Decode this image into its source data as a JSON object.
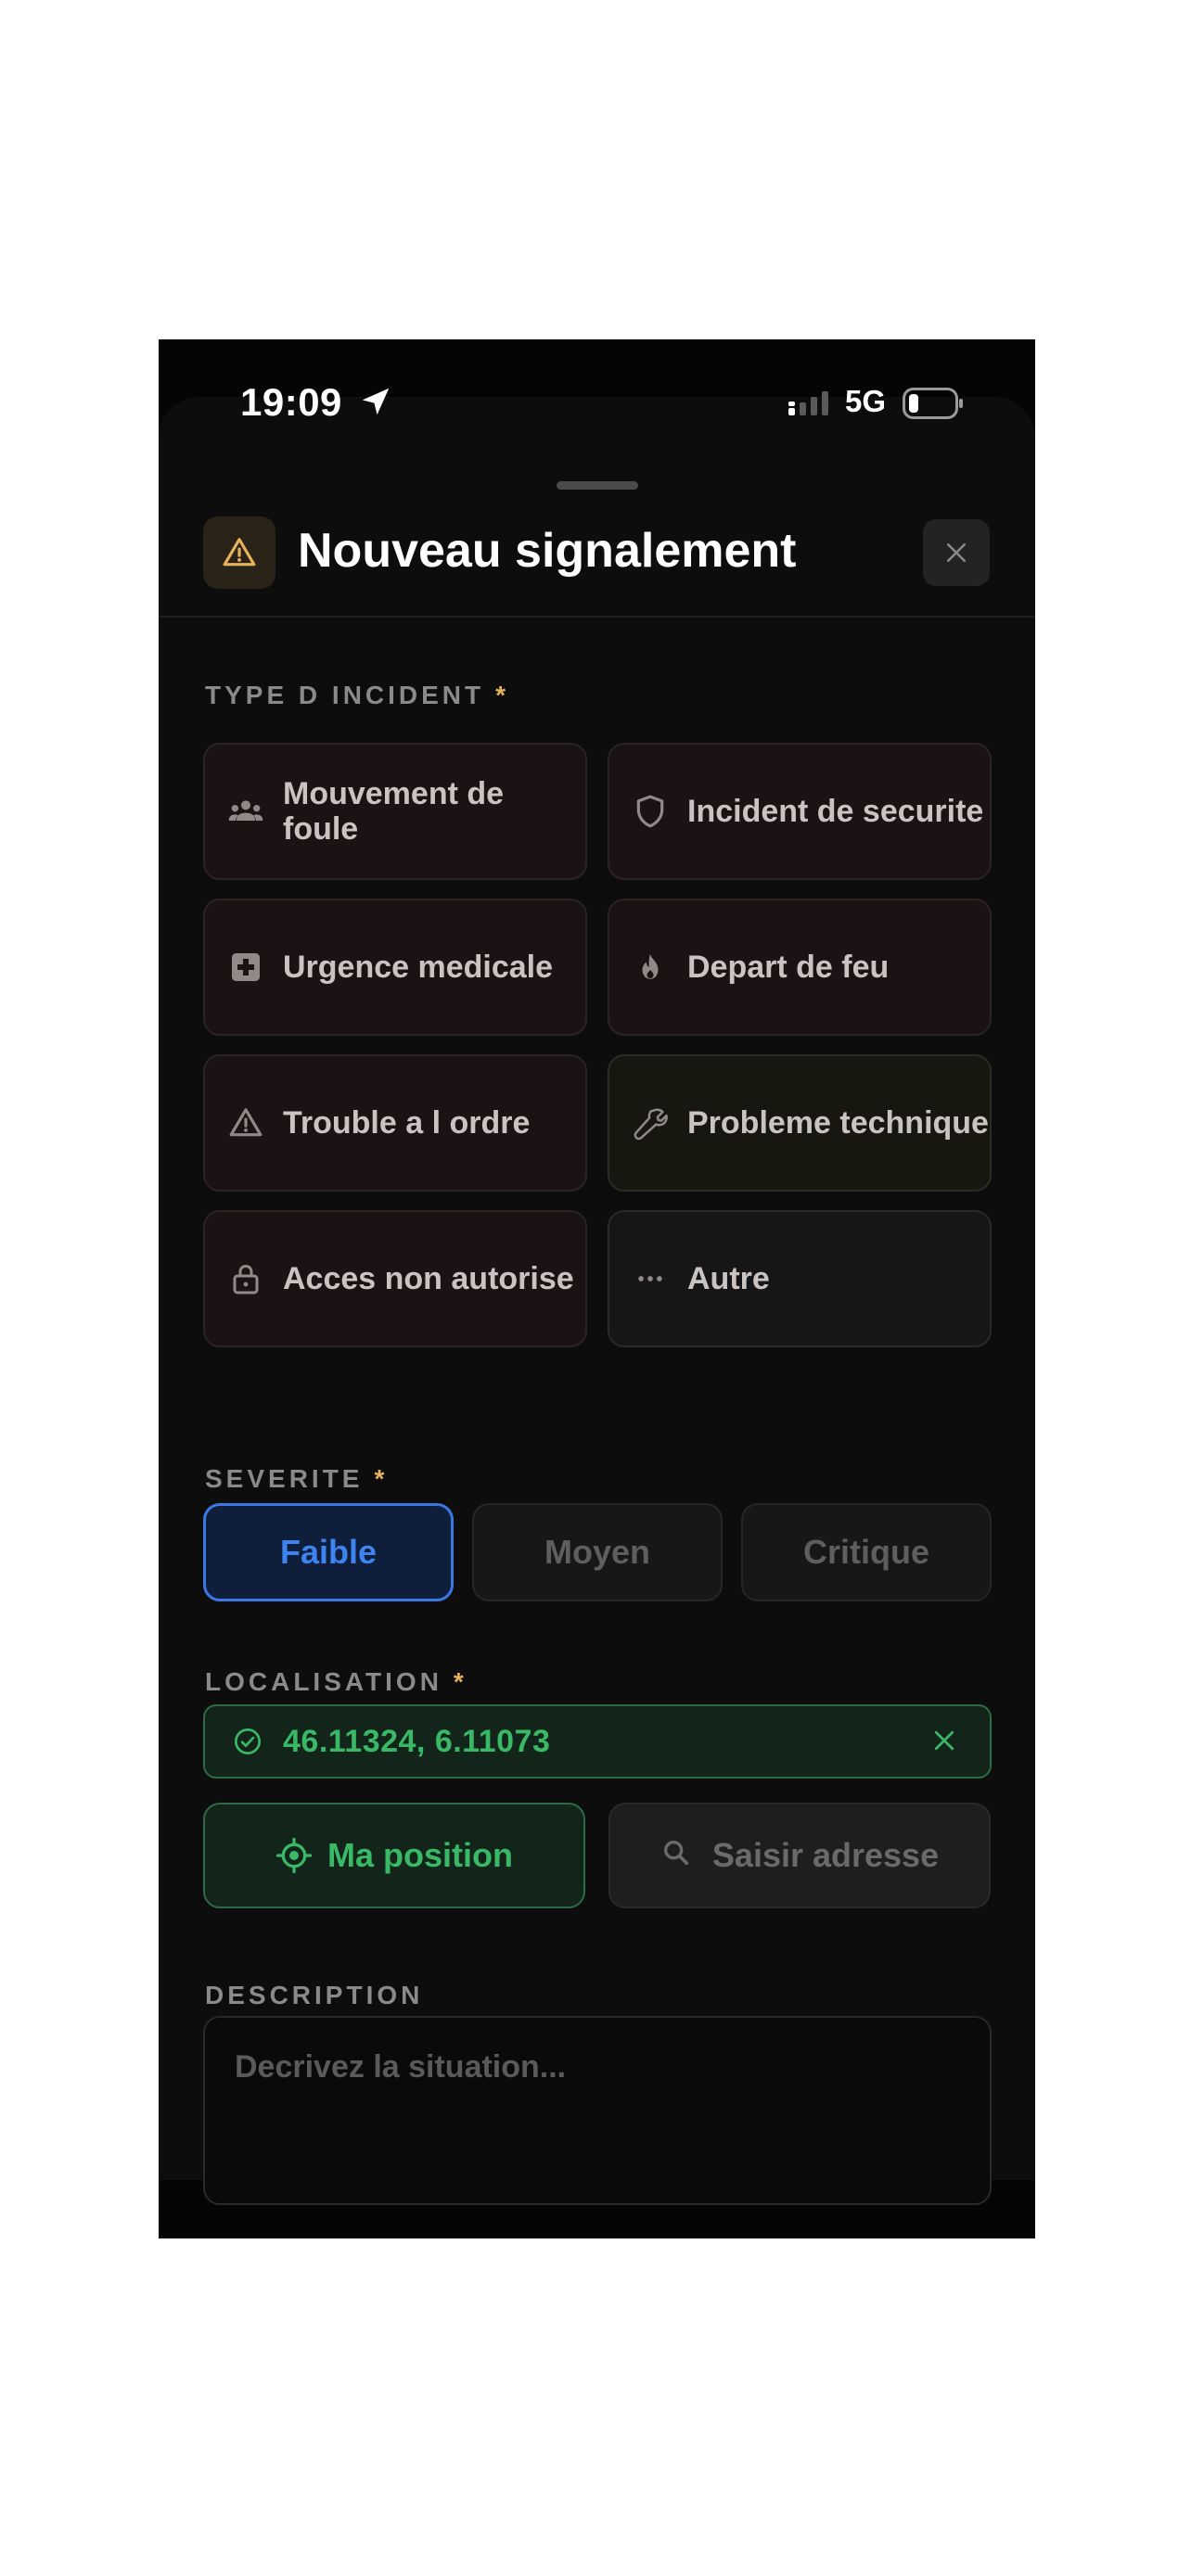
{
  "status_bar": {
    "time": "19:09",
    "network": "5G"
  },
  "header": {
    "title": "Nouveau signalement",
    "icon": "warning-icon",
    "close_icon": "close-icon"
  },
  "incident_type": {
    "label": "TYPE D INCIDENT",
    "required_mark": "*",
    "options": [
      {
        "label": "Mouvement de foule",
        "icon": "crowd-icon"
      },
      {
        "label": "Incident de securite",
        "icon": "shield-icon"
      },
      {
        "label": "Urgence medicale",
        "icon": "medical-icon"
      },
      {
        "label": "Depart de feu",
        "icon": "fire-icon"
      },
      {
        "label": "Trouble a l ordre",
        "icon": "warning-icon"
      },
      {
        "label": "Probleme technique",
        "icon": "wrench-icon"
      },
      {
        "label": "Acces non autorise",
        "icon": "lock-icon"
      },
      {
        "label": "Autre",
        "icon": "ellipsis-icon"
      }
    ]
  },
  "severity": {
    "label": "SEVERITE",
    "required_mark": "*",
    "options": [
      "Faible",
      "Moyen",
      "Critique"
    ],
    "selected": "Faible"
  },
  "location": {
    "label": "LOCALISATION",
    "required_mark": "*",
    "value": "46.11324, 6.11073",
    "my_position_label": "Ma position",
    "address_label": "Saisir adresse"
  },
  "description": {
    "label": "DESCRIPTION",
    "placeholder": "Decrivez la situation..."
  },
  "colors": {
    "accent_blue": "#3b78e6",
    "success_green": "#39b866",
    "warning_amber": "#e6b25c"
  }
}
